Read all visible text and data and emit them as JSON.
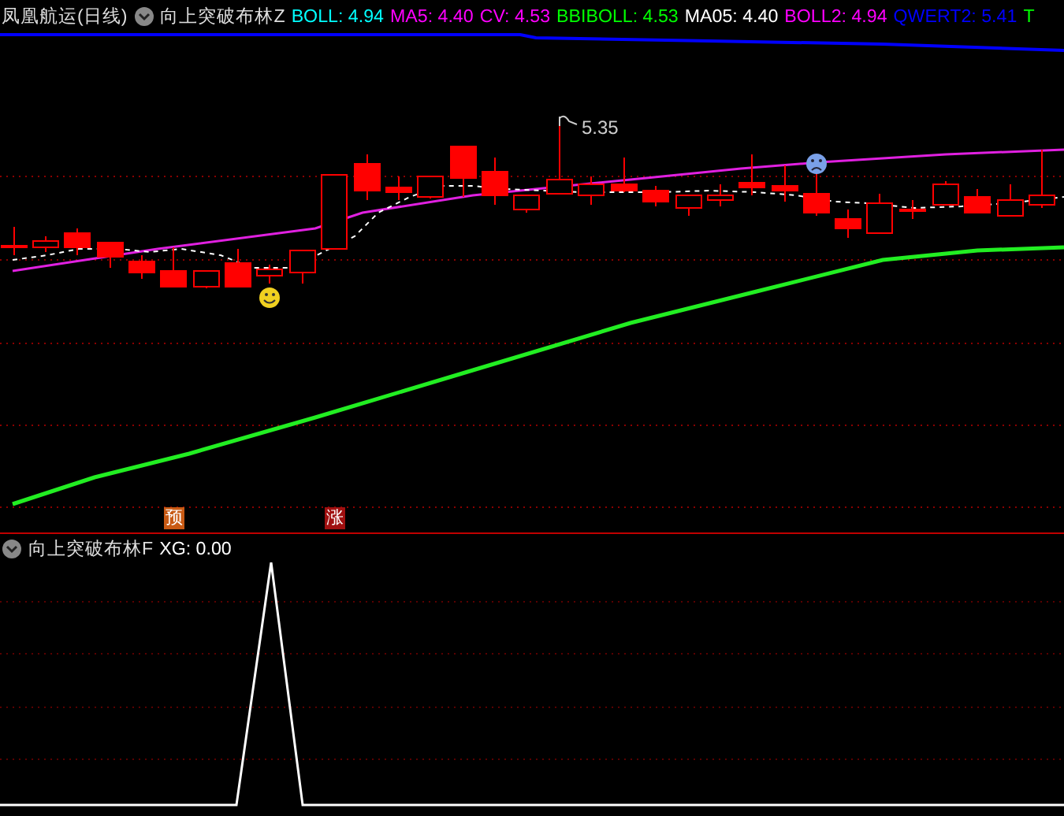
{
  "stock": {
    "name": "凤凰航运(日线)"
  },
  "main_indicator": {
    "name": "向上突破布林Z",
    "values": [
      {
        "label": "BOLL: 4.94",
        "color": "#00ffff"
      },
      {
        "label": "MA5: 4.40",
        "color": "#ff00ff"
      },
      {
        "label": "CV: 4.53",
        "color": "#ff00ff"
      },
      {
        "label": "BBIBOLL: 4.53",
        "color": "#00ff00"
      },
      {
        "label": "MA05: 4.40",
        "color": "#ffffff"
      },
      {
        "label": "BOLL2: 4.94",
        "color": "#ff00ff"
      },
      {
        "label": "QWERT2: 5.41",
        "color": "#0000ff"
      },
      {
        "label": "T",
        "color": "#00ff00"
      }
    ]
  },
  "price_label": "5.35",
  "signals": [
    {
      "label": "预",
      "color": "#c85a14"
    },
    {
      "label": "涨",
      "color": "#a01010"
    }
  ],
  "sub_indicator": {
    "name": "向上突破布林F",
    "values": [
      {
        "label": "XG: 0.00",
        "color": "#ffffff"
      }
    ]
  }
}
